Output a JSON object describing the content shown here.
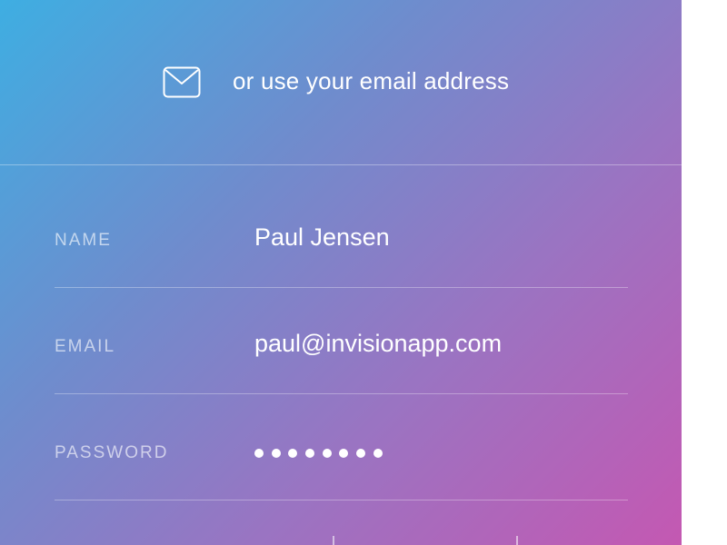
{
  "header": {
    "text": "or use your email address",
    "icon": "mail-icon"
  },
  "form": {
    "name": {
      "label": "NAME",
      "value": "Paul Jensen"
    },
    "email": {
      "label": "EMAIL",
      "value": "paul@invisionapp.com"
    },
    "password": {
      "label": "PASSWORD",
      "masked_length": 8
    }
  },
  "colors": {
    "gradient_start": "#3eaee2",
    "gradient_mid": "#8c7fc6",
    "gradient_end": "#c458b2",
    "text": "#ffffff"
  }
}
